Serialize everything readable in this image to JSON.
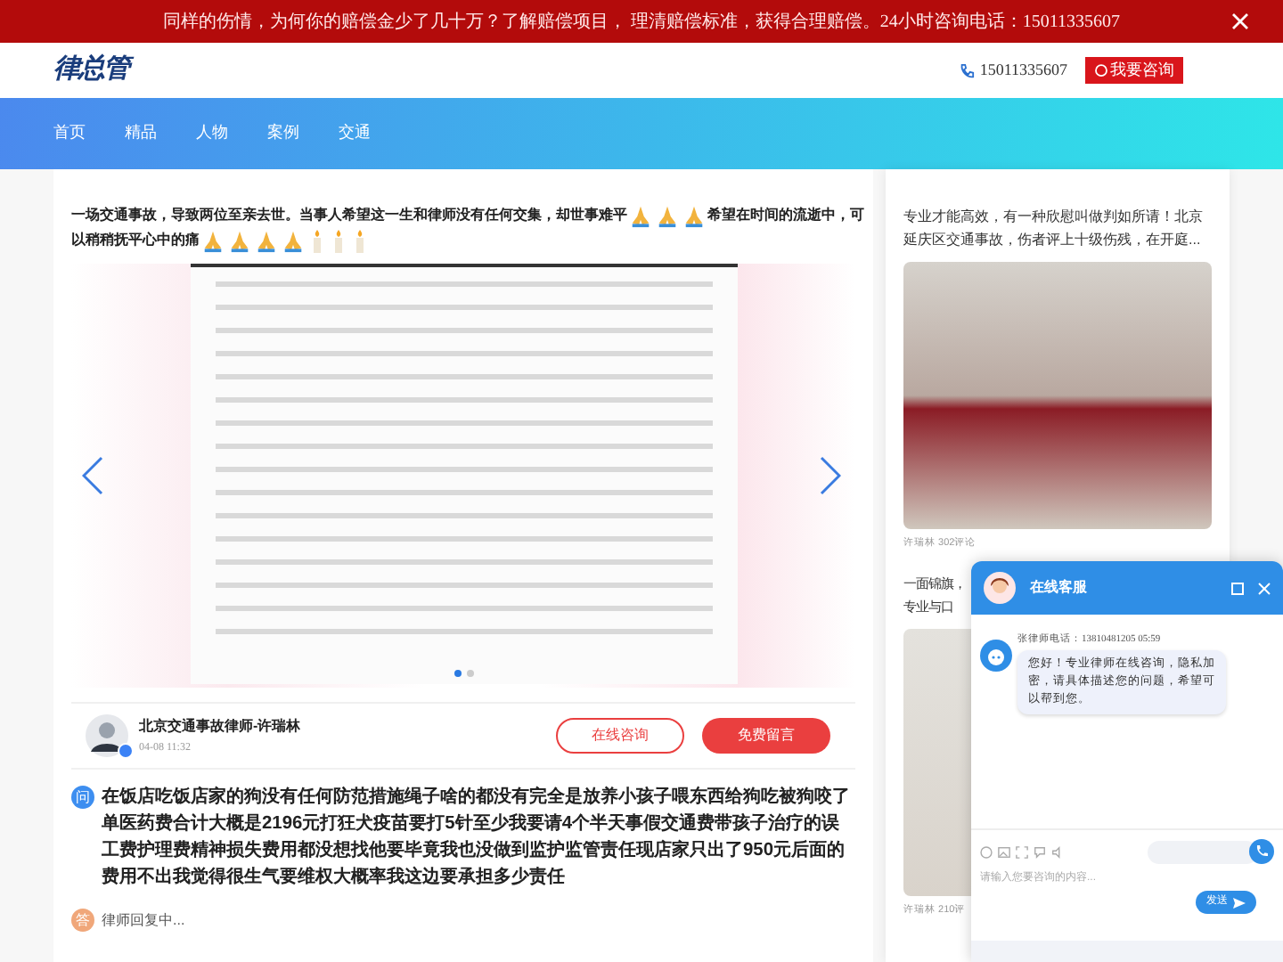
{
  "banner": {
    "text": "同样的伤情，为何你的赔偿金少了几十万？了解赔偿项目， 理清赔偿标准，获得合理赔偿。24小时咨询电话：15011335607"
  },
  "header": {
    "logo": "律总管",
    "phone": "15011335607",
    "consult_button": "我要咨询"
  },
  "nav": [
    {
      "label": "首页",
      "selected": false
    },
    {
      "label": "精品",
      "selected": false
    },
    {
      "label": "人物",
      "selected": false
    },
    {
      "label": "案例",
      "selected": false
    },
    {
      "label": "交通",
      "selected": false
    }
  ],
  "article": {
    "title_lines": [
      [
        {
          "kind": "text",
          "text": "一场交通事故，导致两位至亲去世。当事人希望这一生和律师没有任何交集，却世事难平"
        },
        {
          "kind": "pray"
        },
        {
          "kind": "pray"
        },
        {
          "kind": "pray"
        },
        {
          "kind": "text",
          "text": "希望在时间的流逝中，可"
        }
      ],
      [
        {
          "kind": "text",
          "text": "以稍稍抚平心中的痛"
        },
        {
          "kind": "pray"
        },
        {
          "kind": "pray"
        },
        {
          "kind": "pray"
        },
        {
          "kind": "pray"
        },
        {
          "kind": "candle"
        },
        {
          "kind": "candle"
        },
        {
          "kind": "candle"
        }
      ]
    ],
    "carousel": {
      "dots": [
        {
          "selected": true
        },
        {
          "selected": false
        }
      ]
    },
    "author": {
      "name": "北京交通事故律师-许瑞林",
      "time": "04-08 11:32",
      "verified": true
    },
    "buttons": [
      {
        "label": "在线咨询",
        "kind": "outline"
      },
      {
        "label": "免费留言",
        "kind": "filled"
      }
    ],
    "question": {
      "mark": "问",
      "text": "在饭店吃饭店家的狗没有任何防范措施绳子啥的都没有完全是放养小孩子喂东西给狗吃被狗咬了单医药费合计大概是2196元打狂犬疫苗要打5针至少我要请4个半天事假交通费带孩子治疗的误工费护理费精神损失费用都没想找他要毕竟我也没做到监护监管责任现店家只出了950元后面的费用不出我觉得很生气要维权大概率我这边要承担多少责任"
    },
    "answer": {
      "mark": "答",
      "text": "律师回复中..."
    }
  },
  "sidebar": [
    {
      "text": "专业才能高效，有一种欣慰叫做判如所请！北京延庆区交通事故，伤者评上十级伤残，在开庭...",
      "meta": "许瑞林 302评论"
    },
    {
      "text_lines": [
        "一面锦旗，",
        "专业与口"
      ],
      "meta": "许瑞林 210评"
    }
  ],
  "chat": {
    "title": "在线客服",
    "sender": "张律师电话：13810481205  05:59",
    "message": "您好！专业律师在线咨询，隐私加密，请具体描述您的问题，希望可以帮到您。",
    "placeholder": "请输入您要咨询的内容...",
    "send": "发送"
  }
}
